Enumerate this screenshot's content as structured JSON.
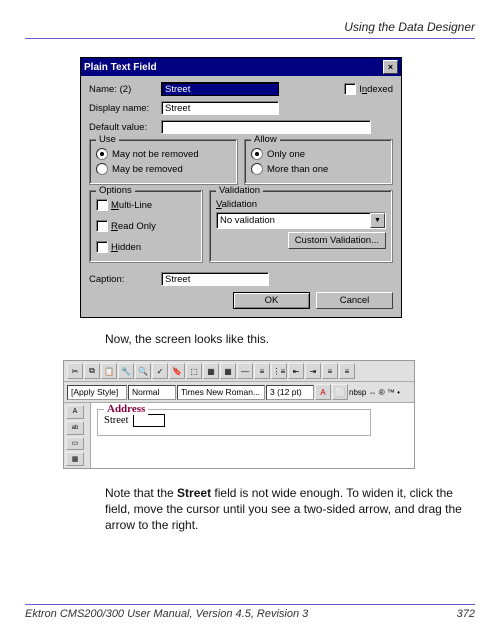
{
  "page": {
    "header": "Using the Data Designer",
    "footer_left": "Ektron CMS200/300 User Manual, Version 4.5, Revision 3",
    "footer_right": "372"
  },
  "dialog": {
    "title": "Plain Text Field",
    "labels": {
      "name": "Name: (2)",
      "displayname": "Display name:",
      "defaultvalue": "Default value:",
      "indexed": "Indexed",
      "use": "Use",
      "allow": "Allow",
      "options": "Options",
      "validation_group": "Validation",
      "validation_label": "Validation",
      "caption": "Caption:"
    },
    "values": {
      "name": "Street",
      "displayname": "Street",
      "defaultvalue": "",
      "validation_select": "No validation",
      "caption": "Street"
    },
    "use": {
      "may_not_be_removed": "May not be removed",
      "may_be_removed": "May be removed",
      "selected": "not_removed"
    },
    "allow": {
      "only_one": "Only one",
      "more_than_one": "More than one",
      "selected": "only_one"
    },
    "options": {
      "multiline": "Multi-Line",
      "readonly": "Read Only",
      "hidden": "Hidden"
    },
    "buttons": {
      "custom_validation": "Custom Validation...",
      "ok": "OK",
      "cancel": "Cancel"
    }
  },
  "body": {
    "caption1": "Now, the screen looks like this.",
    "note_prefix": "Note that the ",
    "note_bold": "Street",
    "note_suffix": " field is not wide enough. To widen it, click the field, move the cursor until you see a two-sided arrow, and drag the arrow to the right."
  },
  "editor": {
    "style_combo": "[Apply Style]",
    "para_combo": "Normal",
    "font_combo": "Times New Roman...",
    "size_combo": "3 (12 pt)",
    "symbols": "nbsp ⇔ ® ™ •",
    "form": {
      "legend": "Address",
      "field_label": "Street"
    }
  }
}
